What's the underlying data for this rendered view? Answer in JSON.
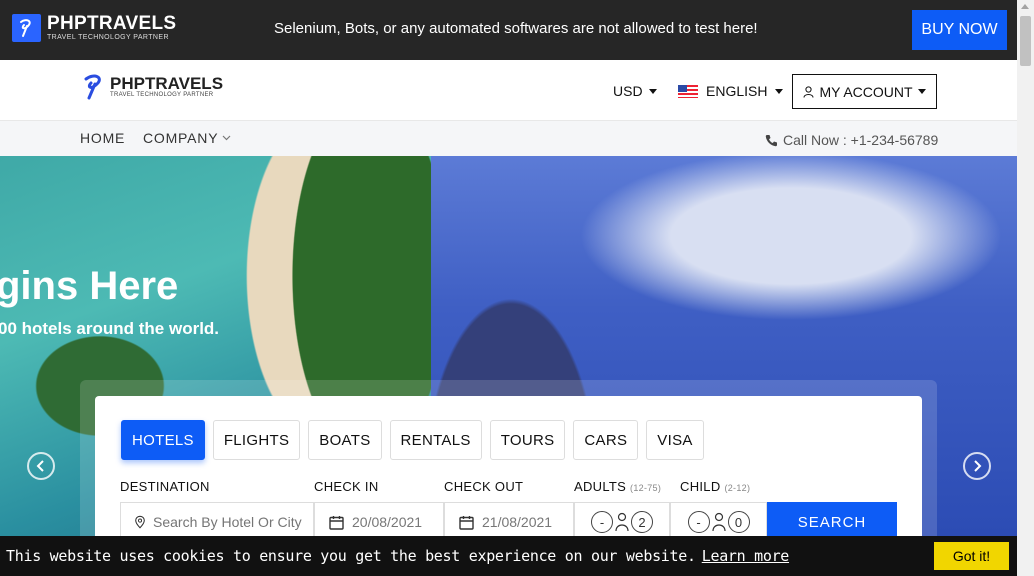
{
  "topbar": {
    "logo_name": "PHPTRAVELS",
    "logo_tag": "TRAVEL TECHNOLOGY PARTNER",
    "notice": "Selenium, Bots, or any automated softwares are not allowed to test here!",
    "buy_now": "BUY NOW"
  },
  "header": {
    "logo_name": "PHPTRAVELS",
    "logo_tag": "TRAVEL TECHNOLOGY PARTNER",
    "currency": "USD",
    "language": "ENGLISH",
    "account": "MY ACCOUNT"
  },
  "nav": {
    "home": "HOME",
    "company": "COMPANY",
    "call": "Call Now : +1-234-56789"
  },
  "hero": {
    "headline": "gins Here",
    "subline": "00 hotels around the world."
  },
  "search": {
    "tabs": [
      "HOTELS",
      "FLIGHTS",
      "BOATS",
      "RENTALS",
      "TOURS",
      "CARS",
      "VISA"
    ],
    "active_tab": "HOTELS",
    "destination_label": "DESTINATION",
    "destination_placeholder": "Search By Hotel Or City",
    "checkin_label": "CHECK IN",
    "checkin_value": "20/08/2021",
    "checkout_label": "CHECK OUT",
    "checkout_value": "21/08/2021",
    "adults_label": "ADULTS",
    "adults_hint": "(12-75)",
    "adults_value": "2",
    "child_label": "CHILD",
    "child_hint": "(2-12)",
    "child_value": "0",
    "search_button": "SEARCH"
  },
  "cookie": {
    "message": "This website uses cookies to ensure you get the best experience on our website.",
    "learn_more": "Learn more",
    "got_it": "Got it!"
  },
  "colors": {
    "accent": "#0d5cf6",
    "topbar_bg": "#262626",
    "cookie_button": "#f1d600"
  }
}
